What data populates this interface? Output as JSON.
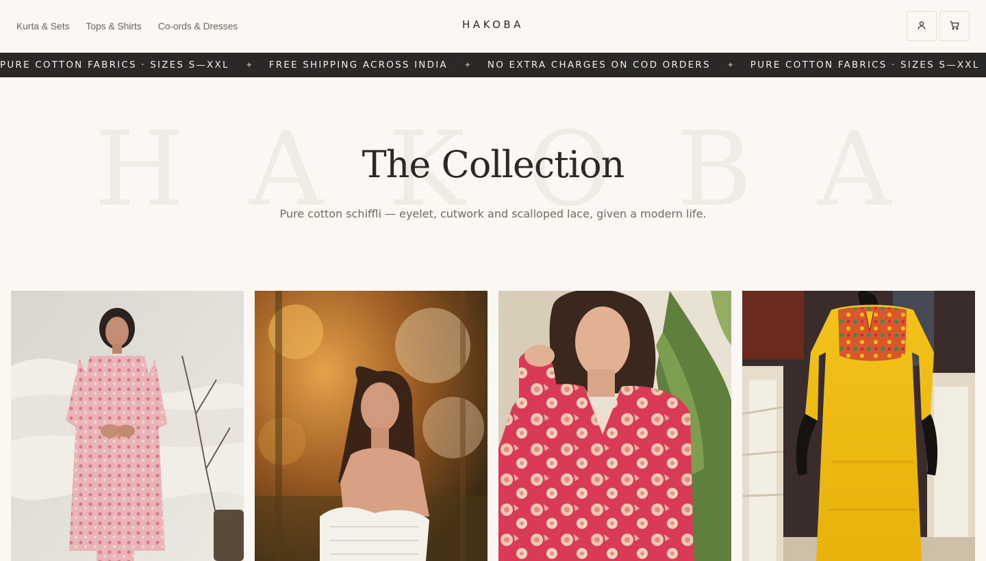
{
  "header": {
    "nav": [
      {
        "label": "Kurta & Sets"
      },
      {
        "label": "Tops & Shirts"
      },
      {
        "label": "Co-ords & Dresses"
      }
    ],
    "brand": "HAKOBA",
    "icons": {
      "account": "user-icon",
      "cart": "cart-icon"
    }
  },
  "marquee": {
    "items": [
      "PURE COTTON FABRICS · SIZES S—XXL",
      "FREE SHIPPING ACROSS INDIA",
      "NO EXTRA CHARGES ON COD ORDERS",
      "PURE COTTON FABRICS · SIZES S—XXL"
    ],
    "separator": "✦"
  },
  "hero": {
    "watermark": "HAKOBA",
    "title": "The Collection",
    "subtitle": "Pure cotton schiffli — eyelet, cutwork and scalloped lace, given a modern life."
  },
  "colors": {
    "background": "#fbf8f3",
    "marquee_bg": "#2a2927",
    "text": "#2b2925",
    "muted": "#6e6961"
  }
}
